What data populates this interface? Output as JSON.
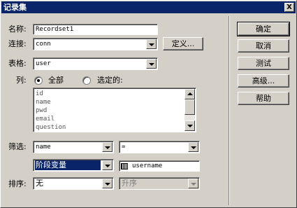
{
  "window": {
    "title": "记录集",
    "close_glyph": "X"
  },
  "form": {
    "name_label": "名称:",
    "name_value": "Recordset1",
    "connection_label": "连接:",
    "connection_value": "conn",
    "define_button": "定义...",
    "table_label": "表格:",
    "table_value": "user",
    "columns_label": "列:",
    "radio_all": "全部",
    "radio_selected": "选定的:",
    "radio_checked": "all",
    "column_items": [
      "id",
      "name",
      "pwd",
      "email",
      "question"
    ],
    "filter_label": "筛选:",
    "filter_column": "name",
    "filter_operator": "=",
    "filter_source": "阶段变量",
    "filter_value": "username",
    "sort_label": "排序:",
    "sort_column": "无",
    "sort_order": "升序"
  },
  "buttons": {
    "ok": "确定",
    "cancel": "取消",
    "test": "测试",
    "advanced": "高级...",
    "help": "帮助"
  },
  "icons": {
    "close": "close-icon",
    "dropdown": "chevron-down-icon",
    "scroll_up": "scroll-up-icon",
    "scroll_down": "scroll-down-icon",
    "parameter": "parameter-icon"
  },
  "colors": {
    "titlebar": "#0a246a",
    "face": "#d4d0c8",
    "selection": "#0a246a"
  }
}
